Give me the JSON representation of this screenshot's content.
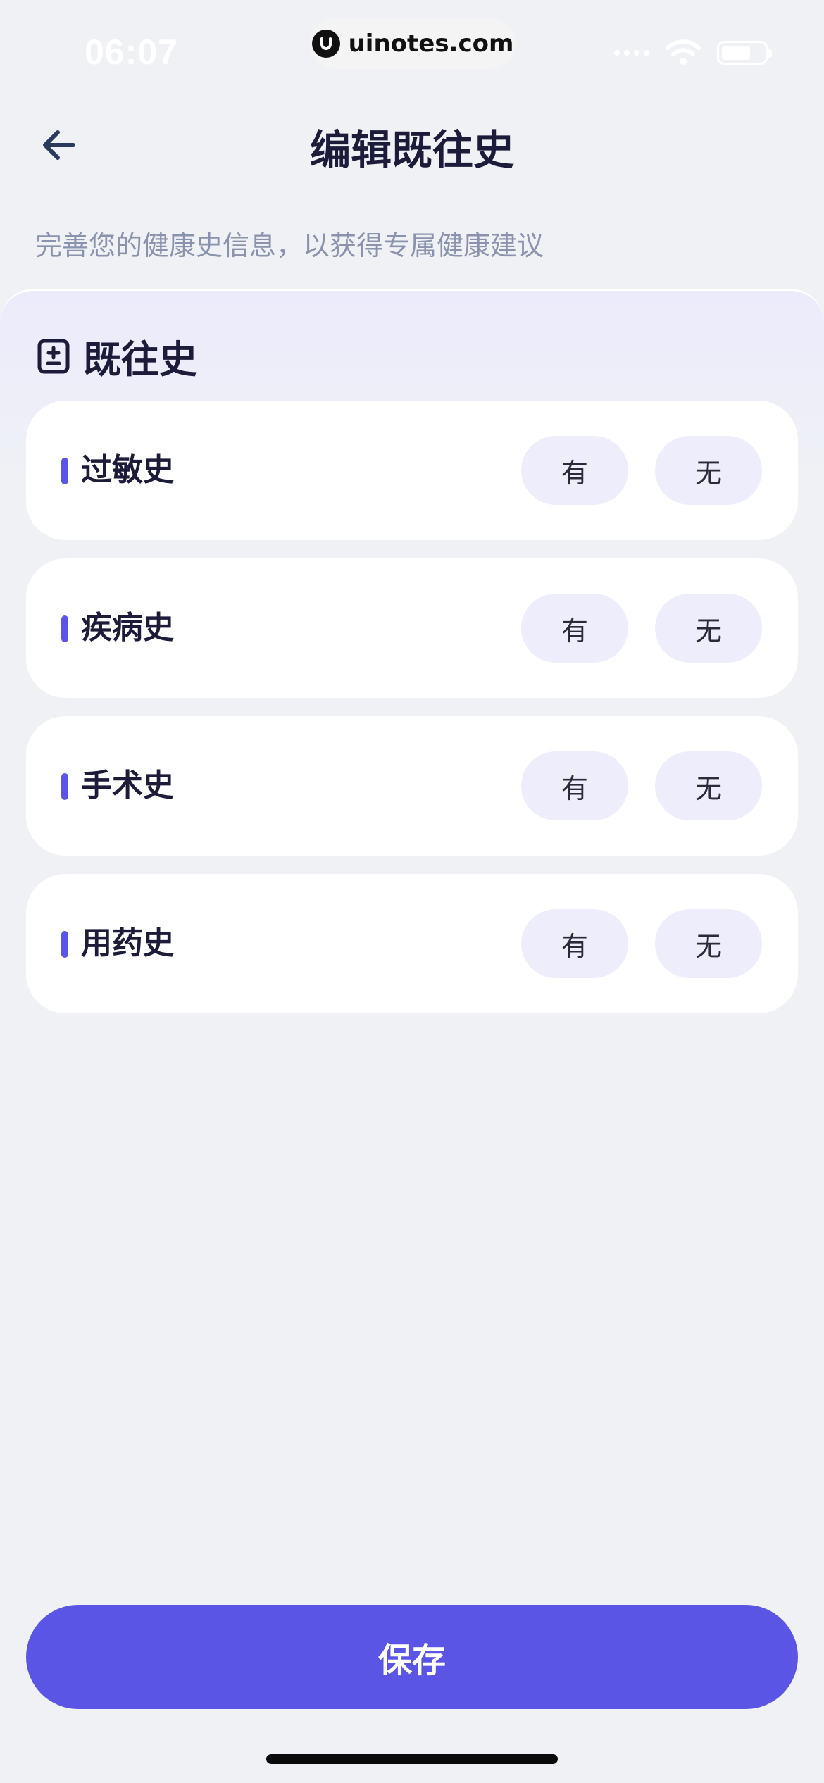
{
  "status_bar": {
    "time": "06:07",
    "watermark": "uinotes.com"
  },
  "header": {
    "title": "编辑既往史",
    "subtitle": "完善您的健康史信息，以获得专属健康建议"
  },
  "section": {
    "title": "既往史",
    "items": [
      {
        "label": "过敏史",
        "yes": "有",
        "no": "无"
      },
      {
        "label": "疾病史",
        "yes": "有",
        "no": "无"
      },
      {
        "label": "手术史",
        "yes": "有",
        "no": "无"
      },
      {
        "label": "用药史",
        "yes": "有",
        "no": "无"
      }
    ]
  },
  "footer": {
    "save_label": "保存"
  },
  "colors": {
    "accent": "#5b55e6",
    "background": "#eff1f5",
    "choice_bg": "#eeedfc",
    "title_text": "#1c1b3a",
    "subtitle_text": "#8b92ad"
  },
  "icons": {
    "back": "arrow-left-icon",
    "section": "medical-record-icon",
    "wifi": "wifi-icon",
    "battery": "battery-icon"
  }
}
